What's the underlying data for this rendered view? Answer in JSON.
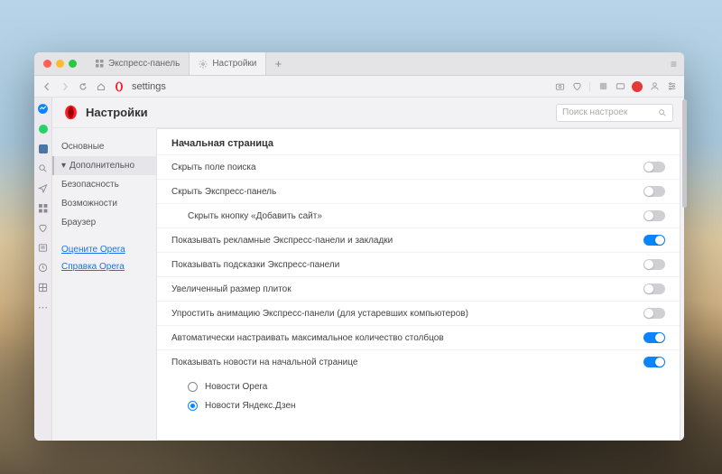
{
  "tabs": [
    {
      "label": "Экспресс-панель"
    },
    {
      "label": "Настройки"
    }
  ],
  "address": {
    "url": "settings"
  },
  "header": {
    "title": "Настройки",
    "search_placeholder": "Поиск настроек"
  },
  "nav": {
    "items": [
      {
        "label": "Основные"
      },
      {
        "label": "Дополнительно"
      },
      {
        "label": "Безопасность"
      },
      {
        "label": "Возможности"
      },
      {
        "label": "Браузер"
      }
    ],
    "links": [
      {
        "label": "Оцените Opera"
      },
      {
        "label": "Справка Opera"
      }
    ]
  },
  "panel": {
    "section_title": "Начальная страница",
    "rows": [
      {
        "label": "Скрыть поле поиска",
        "on": false
      },
      {
        "label": "Скрыть Экспресс-панель",
        "on": false
      },
      {
        "label": "Скрыть кнопку «Добавить сайт»",
        "on": false,
        "sub": true
      },
      {
        "label": "Показывать рекламные Экспресс-панели и закладки",
        "on": true
      },
      {
        "label": "Показывать подсказки Экспресс-панели",
        "on": false
      },
      {
        "label": "Увеличенный размер плиток",
        "on": false
      },
      {
        "label": "Упростить анимацию Экспресс-панели (для устаревших компьютеров)",
        "on": false
      },
      {
        "label": "Автоматически настраивать максимальное количество столбцов",
        "on": true
      },
      {
        "label": "Показывать новости на начальной странице",
        "on": true
      }
    ],
    "radios": [
      {
        "label": "Новости Opera",
        "selected": false
      },
      {
        "label": "Новости Яндекс.Дзен",
        "selected": true
      }
    ]
  }
}
